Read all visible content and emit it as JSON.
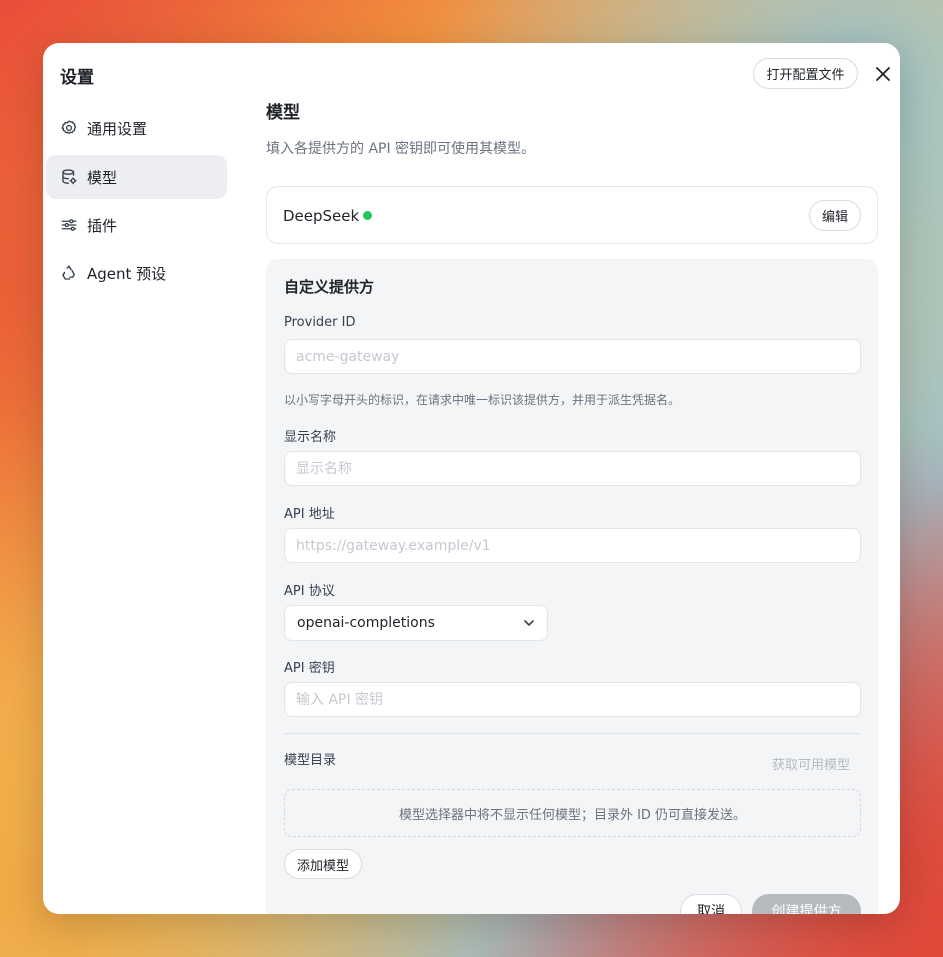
{
  "dialog": {
    "title": "设置",
    "open_config_label": "打开配置文件"
  },
  "sidebar": {
    "items": [
      {
        "label": "通用设置",
        "icon": "gear-icon"
      },
      {
        "label": "模型",
        "icon": "database-icon"
      },
      {
        "label": "插件",
        "icon": "sliders-icon"
      },
      {
        "label": "Agent 预设",
        "icon": "recycle-icon"
      }
    ]
  },
  "main": {
    "title": "模型",
    "description": "填入各提供方的 API 密钥即可使用其模型。",
    "provider_card": {
      "name": "DeepSeek",
      "status_color": "#22c55e",
      "edit_label": "编辑"
    },
    "custom_provider": {
      "title": "自定义提供方",
      "provider_id_label": "Provider ID",
      "provider_id_placeholder": "acme-gateway",
      "provider_id_hint": "以小写字母开头的标识，在请求中唯一标识该提供方，并用于派生凭据名。",
      "display_name_label": "显示名称",
      "display_name_placeholder": "显示名称",
      "api_url_label": "API 地址",
      "api_url_placeholder": "https://gateway.example/v1",
      "api_protocol_label": "API 协议",
      "api_protocol_value": "openai-completions",
      "api_key_label": "API 密钥",
      "api_key_placeholder": "输入 API 密钥",
      "catalog_label": "模型目录",
      "fetch_models_label": "获取可用模型",
      "empty_catalog_text": "模型选择器中将不显示任何模型；目录外 ID 仍可直接发送。",
      "add_model_label": "添加模型",
      "cancel_label": "取消",
      "create_label": "创建提供方"
    }
  }
}
